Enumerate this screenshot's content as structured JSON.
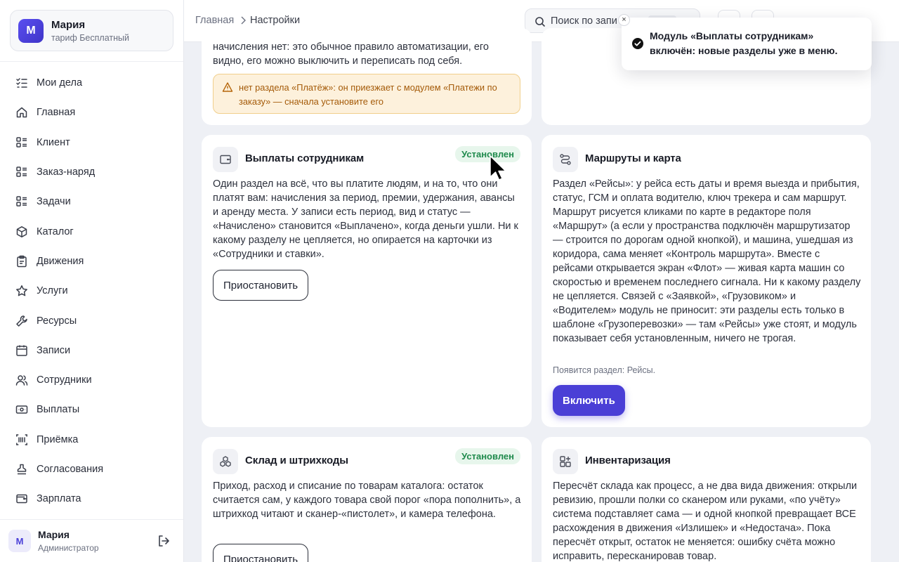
{
  "colors": {
    "accent": "#4a3fd6",
    "installed_bg": "#e7f6ec",
    "installed_text": "#1f8a4c",
    "warning_bg": "#fdf1dc",
    "warning_text": "#a45a08"
  },
  "account": {
    "avatar_letter": "М",
    "name": "Мария",
    "plan": "тариф Бесплатный"
  },
  "sidebar": {
    "items": [
      {
        "label": "Мои дела",
        "icon": "checklist-icon"
      },
      {
        "label": "Главная",
        "icon": "home-icon"
      },
      {
        "label": "Клиент",
        "icon": "list-icon"
      },
      {
        "label": "Заказ-наряд",
        "icon": "list-icon"
      },
      {
        "label": "Задачи",
        "icon": "list-icon"
      },
      {
        "label": "Каталог",
        "icon": "cube-icon"
      },
      {
        "label": "Движения",
        "icon": "clipboard-icon"
      },
      {
        "label": "Услуги",
        "icon": "star-icon"
      },
      {
        "label": "Ресурсы",
        "icon": "wrench-icon"
      },
      {
        "label": "Записи",
        "icon": "calendar-icon"
      },
      {
        "label": "Сотрудники",
        "icon": "users-icon"
      },
      {
        "label": "Выплаты",
        "icon": "banknote-icon"
      },
      {
        "label": "Приёмка",
        "icon": "barcode-icon"
      },
      {
        "label": "Согласования",
        "icon": "stamp-icon"
      },
      {
        "label": "Зарплата",
        "icon": "wallet-icon"
      }
    ]
  },
  "user": {
    "avatar_letter": "М",
    "name": "Мария",
    "role": "Администратор"
  },
  "breadcrumb": {
    "home": "Главная",
    "current": "Настройки"
  },
  "search": {
    "placeholder": "Поиск по запи"
  },
  "toast": {
    "message": "Модуль «Выплаты сотрудникам» включён: новые разделы уже в меню."
  },
  "cards": {
    "top_left": {
      "desc": "начисления нет: это обычное правило автоматизации, его видно, его можно выключить и переписать под себя.",
      "warning": "нет раздела «Платёж»: он приезжает с модулем «Платежи по заказу» — сначала установите его"
    },
    "payouts": {
      "title": "Выплаты сотрудникам",
      "badge": "Установлен",
      "desc": "Один раздел на всё, что вы платите людям, и на то, что они платят вам: начисления за период, премии, удержания, авансы и аренду места. У записи есть период, вид и статус — «Начислено» становится «Выплачено», когда деньги ушли. Ни к какому разделу не цепляется, но опирается на карточки из «Сотрудники и ставки».",
      "button": "Приостановить"
    },
    "routes": {
      "title": "Маршруты и карта",
      "desc": "Раздел «Рейсы»: у рейса есть даты и время выезда и прибытия, статус, ГСМ и оплата водителю, ключ трекера и сам маршрут. Маршрут рисуется кликами по карте в редакторе поля «Маршрут» (а если у пространства подключён маршрутизатор — строится по дорогам одной кнопкой), и машина, ушедшая из коридора, сама меняет «Контроль маршрута». Вместе с рейсами открывается экран «Флот» — живая карта машин со скоростью и временем последнего сигнала. Ни к какому разделу не цепляется. Связей с «Заявкой», «Грузовиком» и «Водителем» модуль не приносит: эти разделы есть только в шаблоне «Грузоперевозки» — там «Рейсы» уже стоят, и модуль показывает себя установленным, ничего не трогая.",
      "hint": "Появится раздел: Рейсы.",
      "button": "Включить"
    },
    "warehouse": {
      "title": "Склад и штрихкоды",
      "badge": "Установлен",
      "desc": "Приход, расход и списание по товарам каталога: остаток считается сам, у каждого товара свой порог «пора пополнить», а штрихкод читают и сканер-«пистолет», и камера телефона.",
      "button": "Приостановить"
    },
    "inventory": {
      "title": "Инвентаризация",
      "desc": "Пересчёт склада как процесс, а не два вида движения: открыли ревизию, прошли полки со сканером или руками, «по учёту» система подставляет сама — и одной кнопкой превращает ВСЕ расхождения в движения «Излишек» и «Недостача». Пока пересчёт открыт, остаток не меняется: ошибку счёта можно исправить, пересканировав товар."
    }
  }
}
